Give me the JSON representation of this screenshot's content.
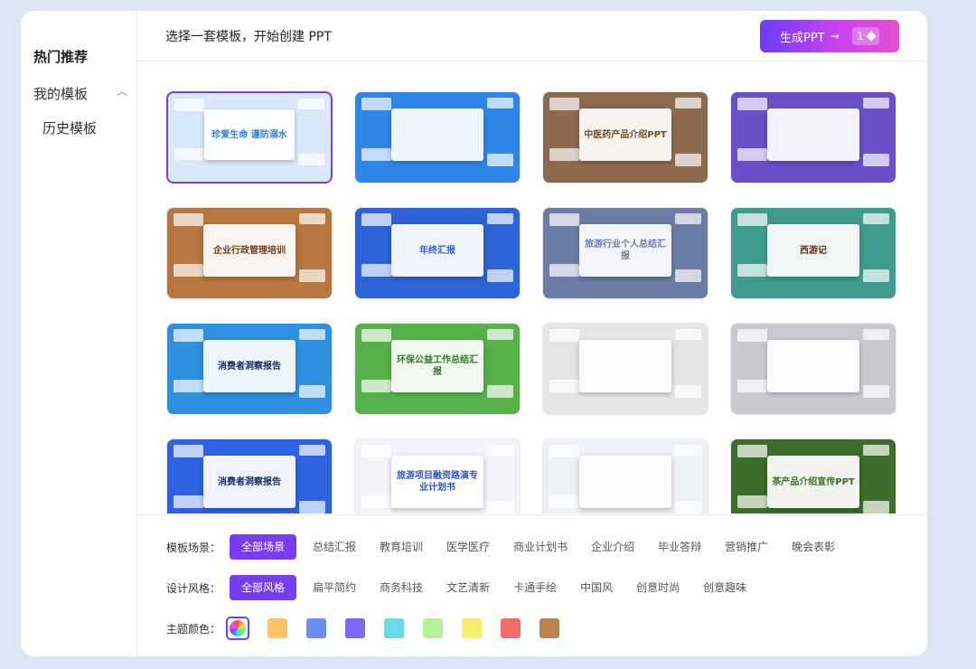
{
  "sidebar": {
    "hot": "热门推荐",
    "mine": "我的模板",
    "history": "历史模板"
  },
  "header": {
    "title": "选择一套模板，开始创建 PPT",
    "generate_label": "生成PPT",
    "generate_arrow": "→",
    "generate_count": "1"
  },
  "templates": [
    {
      "text": "珍爱生命 谨防溺水",
      "bg": "#d7e9fb",
      "accent": "#2f7de1",
      "selected": true
    },
    {
      "text": "",
      "bg": "#2f86e8",
      "accent": "#ffffff",
      "selected": false
    },
    {
      "text": "中医药产品介绍PPT",
      "bg": "#8b6a4d",
      "accent": "#7a4a22",
      "selected": false
    },
    {
      "text": "",
      "bg": "#6a4fc8",
      "accent": "#ffffff",
      "selected": false
    },
    {
      "text": "企业行政管理培训",
      "bg": "#b7773f",
      "accent": "#6b3e16",
      "selected": false
    },
    {
      "text": "年终汇报",
      "bg": "#2d63d6",
      "accent": "#ffffff",
      "selected": false
    },
    {
      "text": "旅游行业个人总结汇报",
      "bg": "#6b7da6",
      "accent": "#ffffff",
      "selected": false
    },
    {
      "text": "西游记",
      "bg": "#3f9c8c",
      "accent": "#5a2d0c",
      "selected": false
    },
    {
      "text": "消费者洞察报告",
      "bg": "#2f8fe0",
      "accent": "#1a2a6e",
      "selected": false
    },
    {
      "text": "环保公益工作总结汇报",
      "bg": "#56b14a",
      "accent": "#2d7a22",
      "selected": false
    },
    {
      "text": "",
      "bg": "#e6e6e6",
      "accent": "#e8802a",
      "selected": false
    },
    {
      "text": "",
      "bg": "#c9c9cf",
      "accent": "#8a5a32",
      "selected": false
    },
    {
      "text": "消费者洞察报告",
      "bg": "#2f62e3",
      "accent": "#1a2a6e",
      "selected": false
    },
    {
      "text": "旅游项目融资路演专业计划书",
      "bg": "#f2f4fa",
      "accent": "#2f55c9",
      "selected": false
    },
    {
      "text": "",
      "bg": "#eef1f5",
      "accent": "#3f86e8",
      "selected": false
    },
    {
      "text": "茶产品介绍宣传PPT",
      "bg": "#3d6d2a",
      "accent": "#ffffff",
      "selected": false
    }
  ],
  "filters": {
    "scene_label": "模板场景：",
    "scenes": [
      {
        "label": "全部场景",
        "active": true
      },
      {
        "label": "总结汇报",
        "active": false
      },
      {
        "label": "教育培训",
        "active": false
      },
      {
        "label": "医学医疗",
        "active": false
      },
      {
        "label": "商业计划书",
        "active": false
      },
      {
        "label": "企业介绍",
        "active": false
      },
      {
        "label": "毕业答辩",
        "active": false
      },
      {
        "label": "营销推广",
        "active": false
      },
      {
        "label": "晚会表彰",
        "active": false
      }
    ],
    "style_label": "设计风格：",
    "styles": [
      {
        "label": "全部风格",
        "active": true
      },
      {
        "label": "扁平简约",
        "active": false
      },
      {
        "label": "商务科技",
        "active": false
      },
      {
        "label": "文艺清新",
        "active": false
      },
      {
        "label": "卡通手绘",
        "active": false
      },
      {
        "label": "中国风",
        "active": false
      },
      {
        "label": "创意时尚",
        "active": false
      },
      {
        "label": "创意趣味",
        "active": false
      }
    ],
    "color_label": "主题颜色：",
    "colors": [
      "#ffc266",
      "#6b8cf5",
      "#7b68f5",
      "#6ad9e8",
      "#b9f09a",
      "#f7ef6b",
      "#f26b6b",
      "#b9824e"
    ]
  }
}
